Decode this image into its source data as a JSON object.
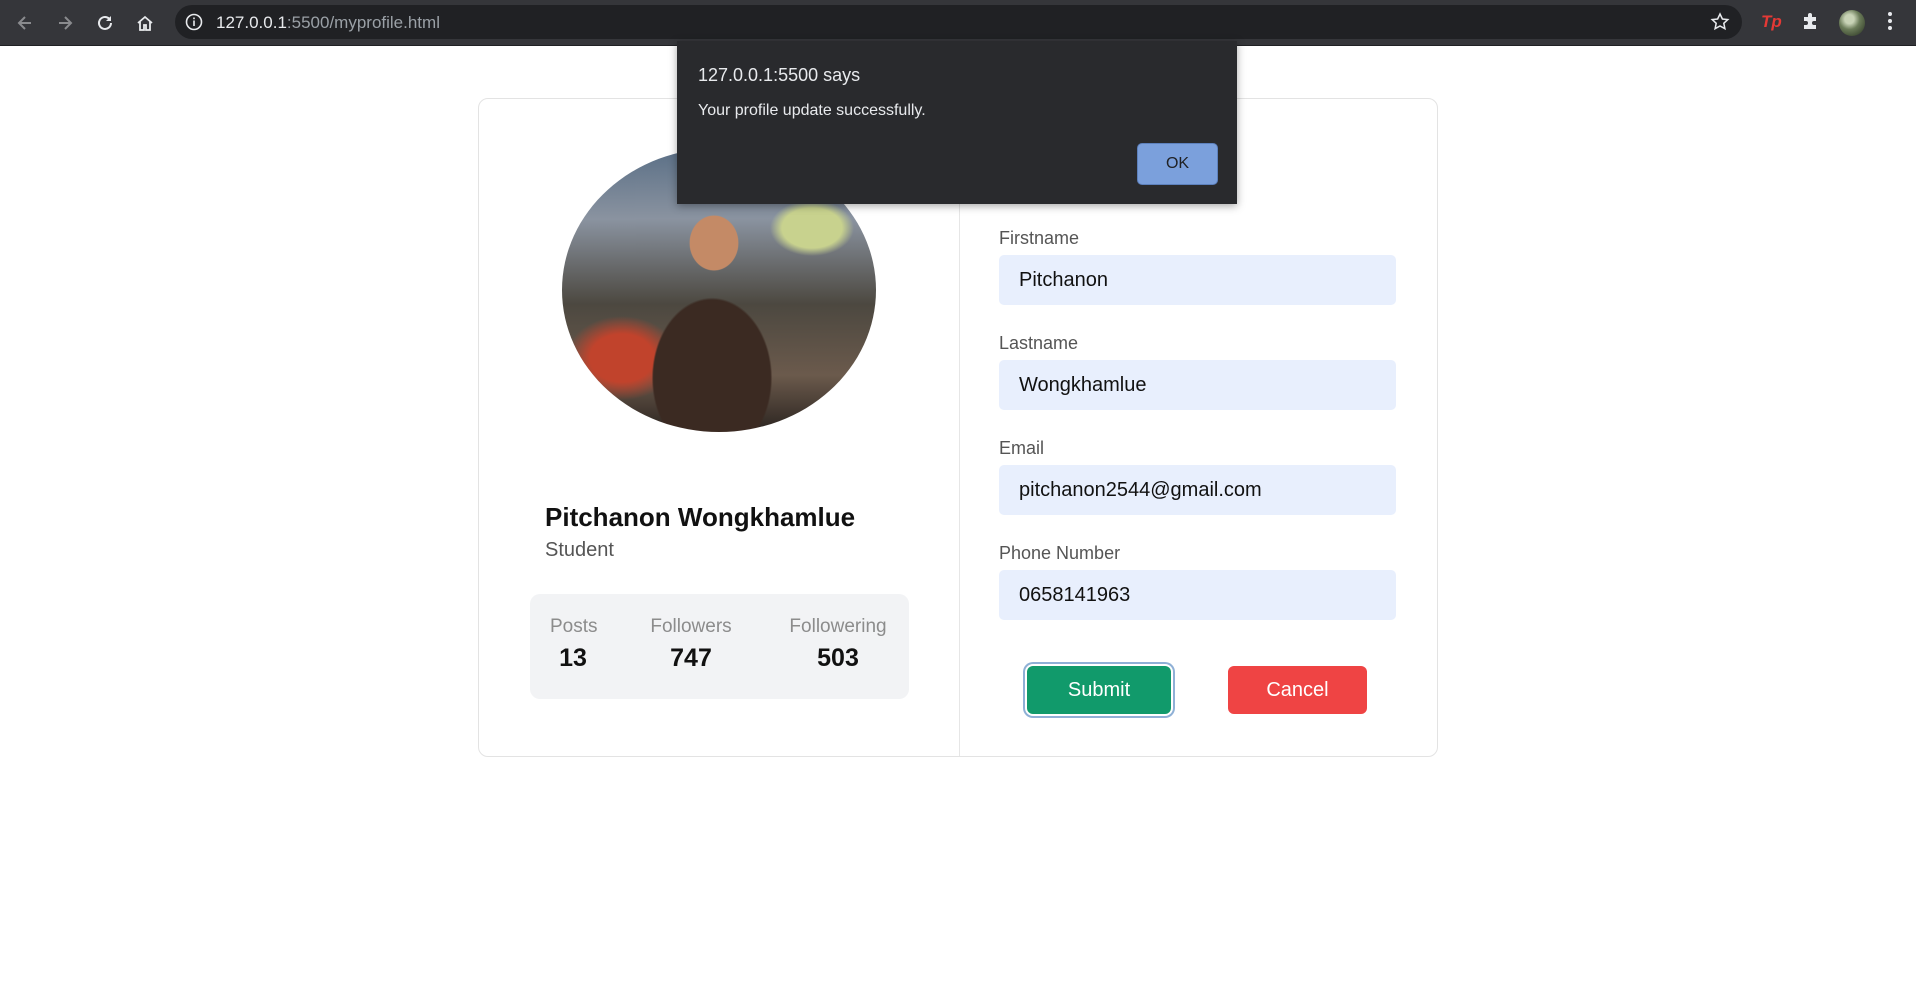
{
  "browser": {
    "url_host": "127.0.0.1",
    "url_rest": ":5500/myprofile.html",
    "extension_label": "Tp"
  },
  "profile": {
    "name": "Pitchanon Wongkhamlue",
    "role": "Student",
    "stats": [
      {
        "label": "Posts",
        "value": "13"
      },
      {
        "label": "Followers",
        "value": "747"
      },
      {
        "label": "Followering",
        "value": "503"
      }
    ]
  },
  "form": {
    "firstname_label": "Firstname",
    "firstname_value": "Pitchanon",
    "lastname_label": "Lastname",
    "lastname_value": "Wongkhamlue",
    "email_label": "Email",
    "email_value": "pitchanon2544@gmail.com",
    "phone_label": "Phone Number",
    "phone_value": "0658141963",
    "submit_label": "Submit",
    "cancel_label": "Cancel"
  },
  "dialog": {
    "title": "127.0.0.1:5500 says",
    "message": "Your profile update successfully.",
    "ok_label": "OK"
  },
  "colors": {
    "submit": "#119a6b",
    "cancel": "#ef4444",
    "input_bg": "#e8effd",
    "dialog_bg": "#292a2d",
    "ok_button": "#7ba0dc"
  }
}
